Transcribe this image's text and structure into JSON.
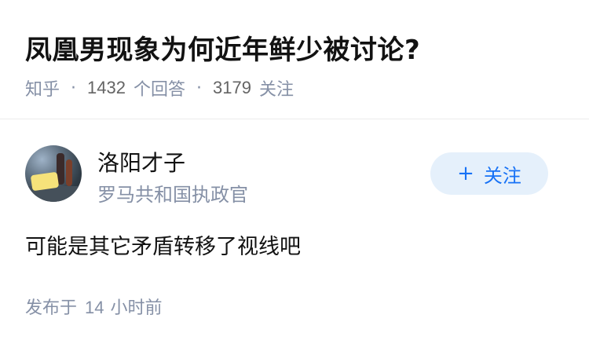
{
  "question": {
    "title": "凤凰男现象为何近年鲜少被讨论?",
    "source": "知乎",
    "separator": "·",
    "answer_count": "1432",
    "answer_label": "个回答",
    "follower_count": "3179",
    "follower_label": "关注"
  },
  "answer": {
    "author": {
      "name": "洛阳才子",
      "headline": "罗马共和国执政官"
    },
    "follow_button": {
      "plus": "+",
      "label": "关注"
    },
    "content": "可能是其它矛盾转移了视线吧",
    "time": {
      "prefix": "发布于",
      "value": "14",
      "suffix": "小时前"
    }
  },
  "colors": {
    "accent": "#1772f6",
    "follow_bg": "#e5f0fb",
    "meta_text": "#8590a6"
  }
}
